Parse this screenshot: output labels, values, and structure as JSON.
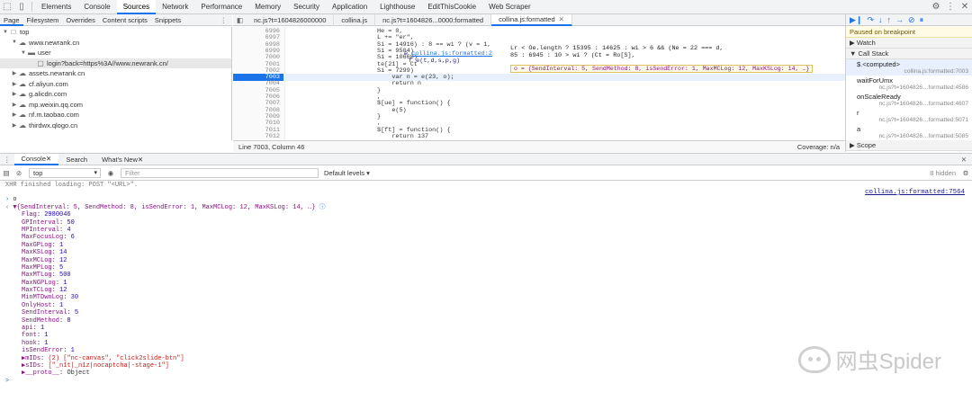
{
  "topbar": {
    "tabs": [
      "Elements",
      "Console",
      "Sources",
      "Network",
      "Performance",
      "Memory",
      "Security",
      "Application",
      "Lighthouse",
      "EditThisCookie",
      "Web Scraper"
    ],
    "active": "Sources"
  },
  "subtabs": {
    "items": [
      "Page",
      "Filesystem",
      "Overrides",
      "Content scripts",
      "Snippets"
    ],
    "more": "⋮"
  },
  "tree": [
    {
      "label": "top",
      "indent": 0,
      "arrow": "▼",
      "icon": "□"
    },
    {
      "label": "www.newrank.cn",
      "indent": 1,
      "arrow": "▼",
      "icon": "☁"
    },
    {
      "label": "user",
      "indent": 2,
      "arrow": "▼",
      "icon": "▬"
    },
    {
      "label": "login?back=https%3A//www.newrank.cn/",
      "indent": 3,
      "arrow": "",
      "icon": "▢",
      "selected": true
    },
    {
      "label": "assets.newrank.cn",
      "indent": 1,
      "arrow": "▶",
      "icon": "☁"
    },
    {
      "label": "cf.aliyun.com",
      "indent": 1,
      "arrow": "▶",
      "icon": "☁"
    },
    {
      "label": "g.alicdn.com",
      "indent": 1,
      "arrow": "▶",
      "icon": "☁"
    },
    {
      "label": "mp.weixin.qq.com",
      "indent": 1,
      "arrow": "▶",
      "icon": "☁"
    },
    {
      "label": "nf.m.taobao.com",
      "indent": 1,
      "arrow": "▶",
      "icon": "☁"
    },
    {
      "label": "thirdwx.qlogo.cn",
      "indent": 1,
      "arrow": "▶",
      "icon": "☁"
    }
  ],
  "editor": {
    "tabs": [
      {
        "label": "nc.js?t=1604826000000",
        "active": false
      },
      {
        "label": "collina.js",
        "active": false
      },
      {
        "label": "nc.js?t=1604826...0000:formatted",
        "active": false
      },
      {
        "label": "collina.js:formatted",
        "active": true
      }
    ],
    "lines": [
      {
        "n": "6996",
        "code": "He = 0,"
      },
      {
        "n": "6997",
        "code": "L += \"er\","
      },
      {
        "n": "6998",
        "code": "Si = 14916) : 8 == wi ? (v = 1,"
      },
      {
        "n": "6999",
        "code": "Si = 9504)"
      },
      {
        "n": "7000",
        "code": "Si = 10660)"
      },
      {
        "n": "7001",
        "code": "te[21] = Ct"
      },
      {
        "n": "7002",
        "code": "Si = 7299)"
      },
      {
        "n": "7003",
        "code": "    var n = e(23, o);",
        "current": true
      },
      {
        "n": "7004",
        "code": "    return n"
      },
      {
        "n": "7005",
        "code": "}"
      },
      {
        "n": "7006",
        "code": ","
      },
      {
        "n": "7007",
        "code": "$[ue] = function() {"
      },
      {
        "n": "7008",
        "code": "    e(5)"
      },
      {
        "n": "7009",
        "code": "}"
      },
      {
        "n": "7010",
        "code": ","
      },
      {
        "n": "7011",
        "code": "$[ft] = function() {"
      },
      {
        "n": "7012",
        "code": "    return 137"
      }
    ],
    "popup_link": "collina.js:formatted:2",
    "popup_prefix": "e",
    "popup_sig": "f e(t,d,s,p,g)",
    "right_code_1": "Lr < Oe.length ? 15395 : 14625 : wi > 6 && (Ne = 22 === d,",
    "right_code_2": "85 : 6945 : 10 > wi ? (Ct = Ro[S],",
    "hover": "o = {SendInterval: 5, SendMethod: 8, isSendError: 1, MaxMCLog: 12, MaxKSLog: 14, …}",
    "status_pos": "Line 7003, Column 46",
    "coverage": "Coverage: n/a"
  },
  "debugger": {
    "paused": "Paused on breakpoint",
    "watch": "Watch",
    "callstack": "Call Stack",
    "frames": [
      {
        "fn": "$.<computed>",
        "loc": "collina.js:formatted:7003",
        "selected": true
      },
      {
        "fn": "waitForUmx",
        "loc": "nc.js?t=1604826…formatted:4586"
      },
      {
        "fn": "onScaleReady",
        "loc": "nc.js?t=1604826…formatted:4607"
      },
      {
        "fn": "r",
        "loc": "nc.js?t=1604826…formatted:5071"
      },
      {
        "fn": "a",
        "loc": "nc.js?t=1604826…formatted:5085"
      }
    ],
    "scope": "Scope"
  },
  "drawer": {
    "tabs": [
      "Console",
      "Search",
      "What's New"
    ],
    "active": "Console"
  },
  "console_toolbar": {
    "context": "top",
    "filter_placeholder": "Filter",
    "levels": "Default levels ▾",
    "hidden": "8 hidden"
  },
  "console": {
    "first": "XHR finished loading: POST \"<URL>\".",
    "source": "collina.js:formatted:7564",
    "input": "o",
    "summary": "▼{SendInterval: 5, SendMethod: 8, isSendError: 1, MaxMCLog: 12, MaxKSLog: 14, …}",
    "props": [
      {
        "k": "Flag",
        "v": "2980046",
        "t": "n"
      },
      {
        "k": "GPInterval",
        "v": "50",
        "t": "n"
      },
      {
        "k": "MPInterval",
        "v": "4",
        "t": "n"
      },
      {
        "k": "MaxFocusLog",
        "v": "6",
        "t": "n"
      },
      {
        "k": "MaxGPLog",
        "v": "1",
        "t": "n"
      },
      {
        "k": "MaxKSLog",
        "v": "14",
        "t": "n"
      },
      {
        "k": "MaxMCLog",
        "v": "12",
        "t": "n"
      },
      {
        "k": "MaxMPLog",
        "v": "5",
        "t": "n"
      },
      {
        "k": "MaxMTLog",
        "v": "500",
        "t": "n"
      },
      {
        "k": "MaxNGPLog",
        "v": "1",
        "t": "n"
      },
      {
        "k": "MaxTCLog",
        "v": "12",
        "t": "n"
      },
      {
        "k": "MinMTDwnLog",
        "v": "30",
        "t": "n"
      },
      {
        "k": "OnlyHost",
        "v": "1",
        "t": "n"
      },
      {
        "k": "SendInterval",
        "v": "5",
        "t": "n"
      },
      {
        "k": "SendMethod",
        "v": "8",
        "t": "n"
      },
      {
        "k": "api",
        "v": "1",
        "t": "n"
      },
      {
        "k": "font",
        "v": "1",
        "t": "n"
      },
      {
        "k": "hook",
        "v": "1",
        "t": "n"
      },
      {
        "k": "isSendError",
        "v": "1",
        "t": "n"
      },
      {
        "k": "▶mIDs",
        "v": "(2) [\"nc-canvas\", \"click2slide-btn\"]",
        "t": "s"
      },
      {
        "k": "▶sIDs",
        "v": "[\"_n1t|_n1z|nocaptcha|-stage-1\"]",
        "t": "s"
      },
      {
        "k": "▶__proto__",
        "v": "Object",
        "t": "o"
      }
    ],
    "prompt": ">"
  },
  "watermark": "网虫Spider"
}
